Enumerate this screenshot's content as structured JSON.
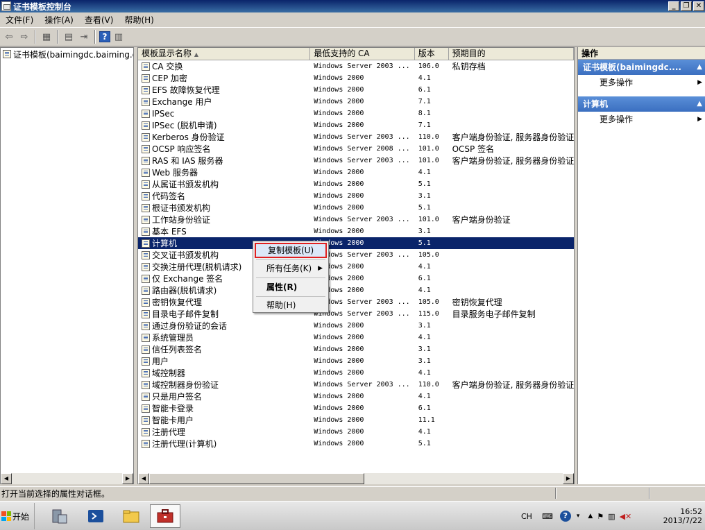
{
  "window": {
    "title": "证书模板控制台"
  },
  "menu": [
    "文件(F)",
    "操作(A)",
    "查看(V)",
    "帮助(H)"
  ],
  "tree": {
    "root_label": "证书模板(baimingdc.baiming.c"
  },
  "columns": [
    "模板显示名称",
    "最低支持的 CA",
    "版本",
    "预期目的"
  ],
  "rows": [
    {
      "name": "CA 交换",
      "ca": "Windows Server 2003 ...",
      "ver": "106.0",
      "purpose": "私钥存档"
    },
    {
      "name": "CEP 加密",
      "ca": "Windows 2000",
      "ver": "4.1",
      "purpose": ""
    },
    {
      "name": "EFS 故障恢复代理",
      "ca": "Windows 2000",
      "ver": "6.1",
      "purpose": ""
    },
    {
      "name": "Exchange 用户",
      "ca": "Windows 2000",
      "ver": "7.1",
      "purpose": ""
    },
    {
      "name": "IPSec",
      "ca": "Windows 2000",
      "ver": "8.1",
      "purpose": ""
    },
    {
      "name": "IPSec (脱机申请)",
      "ca": "Windows 2000",
      "ver": "7.1",
      "purpose": ""
    },
    {
      "name": "Kerberos 身份验证",
      "ca": "Windows Server 2003 ...",
      "ver": "110.0",
      "purpose": "客户端身份验证, 服务器身份验证"
    },
    {
      "name": "OCSP 响应签名",
      "ca": "Windows Server 2008 ...",
      "ver": "101.0",
      "purpose": "OCSP 签名"
    },
    {
      "name": "RAS 和 IAS 服务器",
      "ca": "Windows Server 2003 ...",
      "ver": "101.0",
      "purpose": "客户端身份验证, 服务器身份验证"
    },
    {
      "name": "Web 服务器",
      "ca": "Windows 2000",
      "ver": "4.1",
      "purpose": ""
    },
    {
      "name": "从属证书颁发机构",
      "ca": "Windows 2000",
      "ver": "5.1",
      "purpose": ""
    },
    {
      "name": "代码签名",
      "ca": "Windows 2000",
      "ver": "3.1",
      "purpose": ""
    },
    {
      "name": "根证书颁发机构",
      "ca": "Windows 2000",
      "ver": "5.1",
      "purpose": ""
    },
    {
      "name": "工作站身份验证",
      "ca": "Windows Server 2003 ...",
      "ver": "101.0",
      "purpose": "客户端身份验证"
    },
    {
      "name": "基本 EFS",
      "ca": "Windows 2000",
      "ver": "3.1",
      "purpose": ""
    },
    {
      "name": "计算机",
      "ca": "Windows 2000",
      "ver": "5.1",
      "purpose": "",
      "selected": true
    },
    {
      "name": "交叉证书颁发机构",
      "ca": "Windows Server 2003 ...",
      "ver": "105.0",
      "purpose": ""
    },
    {
      "name": "交换注册代理(脱机请求)",
      "ca": "Windows 2000",
      "ver": "4.1",
      "purpose": ""
    },
    {
      "name": "仅 Exchange 签名",
      "ca": "Windows 2000",
      "ver": "6.1",
      "purpose": ""
    },
    {
      "name": "路由器(脱机请求)",
      "ca": "Windows 2000",
      "ver": "4.1",
      "purpose": ""
    },
    {
      "name": "密钥恢复代理",
      "ca": "Windows Server 2003 ...",
      "ver": "105.0",
      "purpose": "密钥恢复代理"
    },
    {
      "name": "目录电子邮件复制",
      "ca": "Windows Server 2003 ...",
      "ver": "115.0",
      "purpose": "目录服务电子邮件复制"
    },
    {
      "name": "通过身份验证的会话",
      "ca": "Windows 2000",
      "ver": "3.1",
      "purpose": ""
    },
    {
      "name": "系统管理员",
      "ca": "Windows 2000",
      "ver": "4.1",
      "purpose": ""
    },
    {
      "name": "信任列表签名",
      "ca": "Windows 2000",
      "ver": "3.1",
      "purpose": ""
    },
    {
      "name": "用户",
      "ca": "Windows 2000",
      "ver": "3.1",
      "purpose": ""
    },
    {
      "name": "域控制器",
      "ca": "Windows 2000",
      "ver": "4.1",
      "purpose": ""
    },
    {
      "name": "域控制器身份验证",
      "ca": "Windows Server 2003 ...",
      "ver": "110.0",
      "purpose": "客户端身份验证, 服务器身份验证"
    },
    {
      "name": "只是用户签名",
      "ca": "Windows 2000",
      "ver": "4.1",
      "purpose": ""
    },
    {
      "name": "智能卡登录",
      "ca": "Windows 2000",
      "ver": "6.1",
      "purpose": ""
    },
    {
      "name": "智能卡用户",
      "ca": "Windows 2000",
      "ver": "11.1",
      "purpose": ""
    },
    {
      "name": "注册代理",
      "ca": "Windows 2000",
      "ver": "4.1",
      "purpose": ""
    },
    {
      "name": "注册代理(计算机)",
      "ca": "Windows 2000",
      "ver": "5.1",
      "purpose": ""
    }
  ],
  "context_menu": {
    "duplicate": "复制模板(U)",
    "all_tasks": "所有任务(K)",
    "properties": "属性(R)",
    "help": "帮助(H)"
  },
  "actions": {
    "title": "操作",
    "section1": "证书模板(baimingdc....",
    "section1_item": "更多操作",
    "section2": "计算机",
    "section2_item": "更多操作"
  },
  "status": {
    "text": "打开当前选择的属性对话框。"
  },
  "taskbar": {
    "start": "开始",
    "lang": "CH",
    "time": "16:52",
    "date": "2013/7/22"
  },
  "colors": {
    "selection": "#0a246a",
    "highlight_border": "#e02020",
    "action_header": "#3b6fc0"
  }
}
